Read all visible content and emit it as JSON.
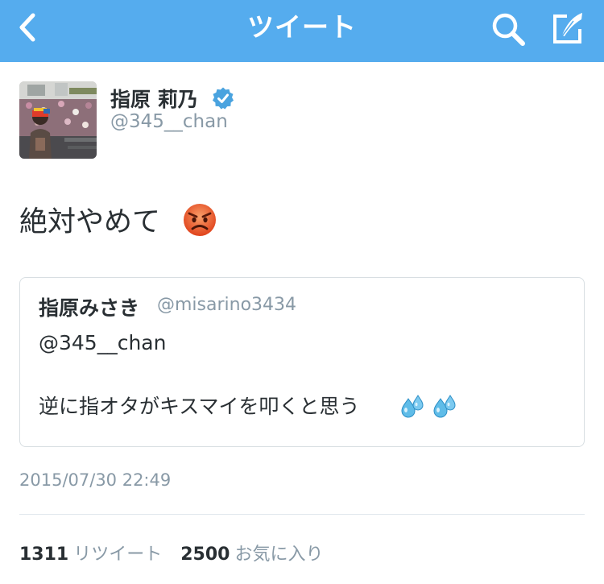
{
  "nav": {
    "title": "ツイート",
    "icons": {
      "back": "chevron-left-icon",
      "search": "search-icon",
      "compose": "compose-icon"
    },
    "color": "#55acee"
  },
  "tweet": {
    "author": {
      "name": "指原 莉乃",
      "handle": "@345__chan",
      "verified": true
    },
    "text": "絶対やめて",
    "emoji": "angry-face-icon",
    "quoted": {
      "name": "指原みさき",
      "handle": "@misarino3434",
      "reply_to": "@345__chan",
      "text": "逆に指オタがキスマイを叩くと思う",
      "emoji": [
        "sweat-droplets-icon",
        "sweat-droplets-icon"
      ]
    },
    "timestamp": "2015/07/30 22:49",
    "stats": {
      "retweets": {
        "count": "1311",
        "label": "リツイート"
      },
      "favorites": {
        "count": "2500",
        "label": "お気に入り"
      }
    }
  },
  "colors": {
    "verified": "#4aa3df",
    "secondary_text": "#8899a6",
    "primary_text": "#292f33"
  }
}
